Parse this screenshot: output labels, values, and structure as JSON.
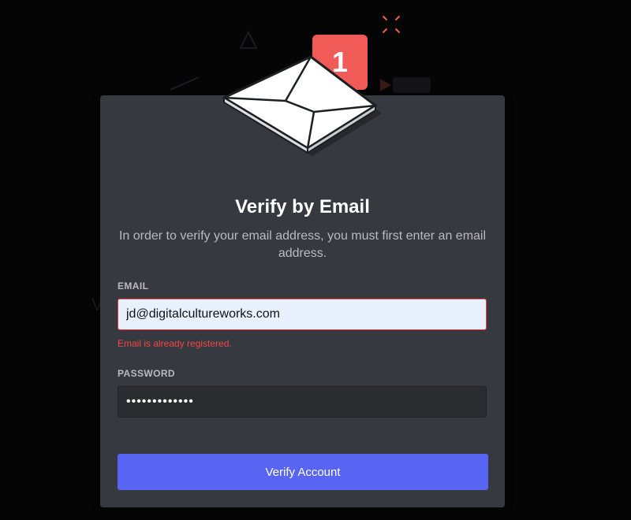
{
  "badge": {
    "count": "1"
  },
  "modal": {
    "title": "Verify by Email",
    "subtitle": "In order to verify your email address, you must first enter an email address."
  },
  "form": {
    "email_label": "EMAIL",
    "email_value": "jd@digitalcultureworks.com",
    "email_error": "Email is already registered.",
    "password_label": "PASSWORD",
    "password_value": "•••••••••••••"
  },
  "actions": {
    "verify_label": "Verify Account"
  },
  "icons": {
    "envelope": "envelope-icon",
    "sparkle": "sparkle-icon"
  },
  "colors": {
    "accent": "#5865f2",
    "badge": "#f05a57",
    "error": "#f04747",
    "modal_bg": "#36393f",
    "page_bg": "#050505"
  }
}
